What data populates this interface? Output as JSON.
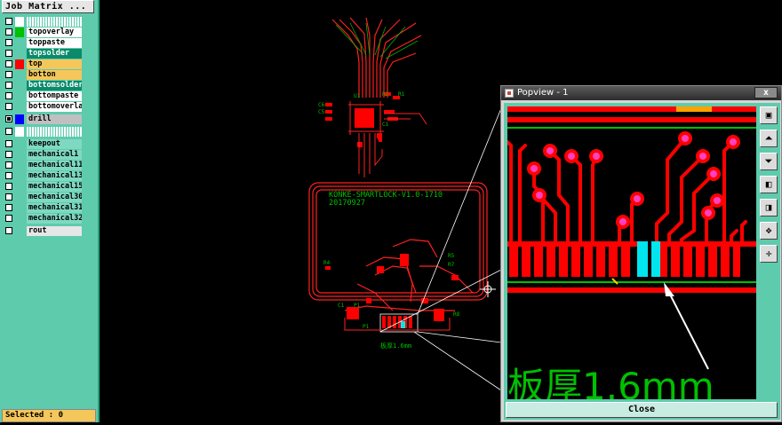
{
  "left_panel": {
    "job_matrix_label": "Job Matrix ...",
    "layers": [
      {
        "name": "",
        "color": "#ffffff",
        "bg": "#7fd9c2",
        "checked": false,
        "row_kind": "header"
      },
      {
        "name": "topoverlay",
        "color": "#00c000",
        "bg": "#ffffff",
        "checked": false
      },
      {
        "name": "toppaste",
        "color": "",
        "bg": "#ffffff",
        "checked": false
      },
      {
        "name": "topsolder",
        "color": "",
        "bg": "#0a8a6a",
        "checked": false
      },
      {
        "name": "top",
        "color": "#ff0000",
        "bg": "#f5c75a",
        "checked": false
      },
      {
        "name": "botton",
        "color": "",
        "bg": "#f5c75a",
        "checked": false
      },
      {
        "name": "bottomsolder",
        "color": "",
        "bg": "#0a8a6a",
        "checked": false
      },
      {
        "name": "bottompaste",
        "color": "",
        "bg": "#ffffff",
        "checked": false
      },
      {
        "name": "bottomoverlay",
        "color": "",
        "bg": "#ffffff",
        "checked": false
      },
      {
        "name": "drill",
        "color": "#0000ff",
        "bg": "#c0c0c0",
        "checked": true
      },
      {
        "name": "",
        "color": "#ffffff",
        "bg": "#7fd9c2",
        "checked": false,
        "row_kind": "header"
      },
      {
        "name": "keepout",
        "color": "",
        "bg": "#7fd9c2",
        "checked": false
      },
      {
        "name": "mechanical1",
        "color": "",
        "bg": "#7fd9c2",
        "checked": false
      },
      {
        "name": "mechanical11",
        "color": "",
        "bg": "#7fd9c2",
        "checked": false
      },
      {
        "name": "mechanical13",
        "color": "",
        "bg": "#7fd9c2",
        "checked": false
      },
      {
        "name": "mechanical15",
        "color": "",
        "bg": "#7fd9c2",
        "checked": false
      },
      {
        "name": "mechanical30",
        "color": "",
        "bg": "#7fd9c2",
        "checked": false
      },
      {
        "name": "mechanical31",
        "color": "",
        "bg": "#7fd9c2",
        "checked": false
      },
      {
        "name": "mechanical32",
        "color": "",
        "bg": "#7fd9c2",
        "checked": false
      },
      {
        "name": "rout",
        "color": "",
        "bg": "#e6e6e6",
        "checked": false
      }
    ],
    "selected_label": "Selected : 0"
  },
  "board": {
    "silkscreen_line1": "KONKE-SMARTLOCK-V1.0-1710",
    "silkscreen_line2": "20170927",
    "thickness_label": "板厚1.6mm"
  },
  "popup": {
    "title": "Popview - 1",
    "close_x": "x",
    "close_label": "Close",
    "zoom_text": "板厚1.6mm",
    "tools": [
      "fit-icon",
      "pan-up-icon",
      "pan-down-icon",
      "pan-left-icon",
      "pan-right-icon",
      "zoom-in-icon",
      "zoom-out-icon"
    ]
  },
  "colors": {
    "background": "#000000",
    "panel": "#5ecbad",
    "copper": "#ff0000",
    "silkscreen": "#00c000",
    "pad_highlight": "#00e5ee",
    "via": "#ff40c0"
  }
}
